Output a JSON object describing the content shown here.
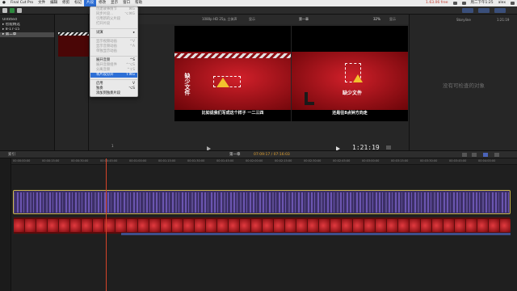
{
  "menubar": {
    "app": "Final Cut Pro",
    "items": [
      "文件",
      "编辑",
      "修剪",
      "标记",
      "片段",
      "修改",
      "显示",
      "窗口",
      "帮助"
    ],
    "active_index": 4,
    "right_status": "1.63.06 free",
    "clock": "周二下午1:25",
    "user": "alex"
  },
  "clip_menu": {
    "items": [
      {
        "label": "创建故事情节",
        "shortcut": "⌘G",
        "disabled": true
      },
      {
        "label": "同步片段...",
        "shortcut": "⌥⌘G",
        "disabled": true
      },
      {
        "label": "引用新的父片段",
        "shortcut": "",
        "disabled": true
      },
      {
        "label": "打开片段",
        "shortcut": "",
        "disabled": true
      },
      {
        "sep": true
      },
      {
        "label": "试演",
        "shortcut": "▸",
        "disabled": false
      },
      {
        "sep": true
      },
      {
        "label": "显示视频动画",
        "shortcut": "^V",
        "disabled": true
      },
      {
        "label": "显示音频动画",
        "shortcut": "^A",
        "disabled": true
      },
      {
        "label": "单独显示动画",
        "shortcut": "",
        "disabled": true
      },
      {
        "sep": true
      },
      {
        "label": "展开音频",
        "shortcut": "^S",
        "disabled": false
      },
      {
        "label": "展开音频组件",
        "shortcut": "^⌥S",
        "disabled": true
      },
      {
        "label": "分离音频",
        "shortcut": "^⇧S",
        "disabled": true
      },
      {
        "label": "将片段分开",
        "shortcut": "⇧⌘G",
        "disabled": false,
        "highlighted": true
      },
      {
        "sep": true
      },
      {
        "label": "启用",
        "shortcut": "V",
        "disabled": false
      },
      {
        "label": "独奏",
        "shortcut": "⌥S",
        "disabled": false
      },
      {
        "label": "添加到独奏片段",
        "shortcut": "",
        "disabled": false
      }
    ]
  },
  "library": {
    "rows": [
      {
        "label": "Untitled",
        "selected": false
      },
      {
        "label": "▸ 智能精选",
        "selected": false
      },
      {
        "label": "▸ 8-17-15",
        "selected": false
      },
      {
        "label": "▸ 第二章",
        "selected": true
      }
    ]
  },
  "viewer": {
    "format": "1080p HD 25p, 立体声",
    "dropdown": "显示",
    "title": "第一章",
    "zoom": "32%",
    "view_btn": "显示",
    "count": "1",
    "timecode": "1:21:19"
  },
  "video_left": {
    "vertical_text": "缺少文件",
    "caption": "比如说我们写成这个样子 一二三四"
  },
  "video_right": {
    "title_text": "缺少文件",
    "caption": "还是往8点钟方向走"
  },
  "inspector": {
    "empty_text": "没有可检查的对象",
    "tab": "Storyline",
    "tc": "1:21:19"
  },
  "timeline": {
    "index_label": "索引",
    "project": "第一章",
    "tc": "07:09:17 / 07:16:03",
    "ticks": [
      "00:00:00:00",
      "00:00:15:00",
      "00:00:30:00",
      "00:00:45:00",
      "00:01:00:00",
      "00:01:15:00",
      "00:01:30:00",
      "00:01:45:00",
      "00:02:00:00",
      "00:02:15:00",
      "00:02:30:00",
      "00:02:45:00",
      "00:03:00:00",
      "00:03:15:00",
      "00:03:30:00",
      "00:03:45:00",
      "00:04:00:00"
    ]
  },
  "colors": {
    "accent": "#2d6fd6",
    "clip_audio": "#3c2f66",
    "clip_video": "#5a0c0c",
    "selection": "#c9b44a",
    "playhead": "#d4442a"
  }
}
